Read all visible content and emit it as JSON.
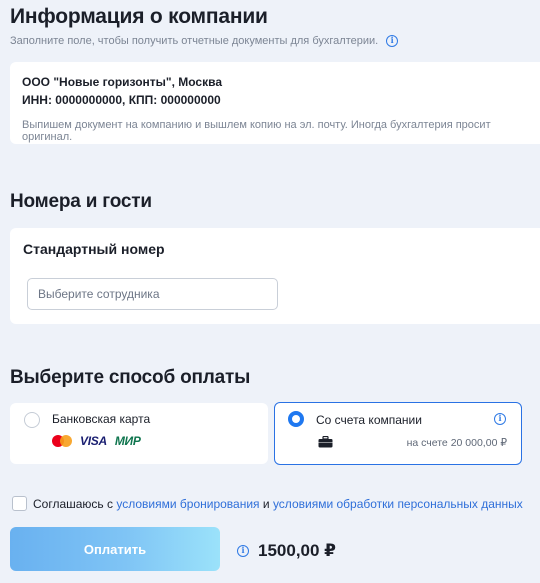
{
  "company_section": {
    "title": "Информация о компании",
    "hint": "Заполните поле, чтобы получить отчетные документы для бухгалтерии.",
    "name_line": "ООО \"Новые горизонты\", Москва",
    "ids_line": "ИНН: 0000000000, КПП: 000000000",
    "note": "Выпишем документ на компанию и вышлем копию на эл. почту. Иногда бухгалтерия просит оригинал."
  },
  "rooms_section": {
    "title": "Номера и гости",
    "room_title": "Стандартный номер",
    "employee_placeholder": "Выберите сотрудника"
  },
  "payment_section": {
    "title": "Выберите способ оплаты",
    "options": [
      {
        "label": "Банковская карта",
        "selected": false,
        "logos": [
          "mastercard-icon",
          "VISA",
          "МИР"
        ]
      },
      {
        "label": "Со счета компании",
        "selected": true,
        "balance": "на счете 20 000,00 ₽"
      }
    ]
  },
  "agreement": {
    "prefix": "Соглашаюсь с",
    "link1": "условиями бронирования",
    "middle": "и",
    "link2": "условиями обработки персональных данных",
    "checked": false
  },
  "checkout": {
    "pay_label": "Оплатить",
    "total": "1500,00 ₽"
  },
  "colors": {
    "accent": "#2a72e4",
    "background": "#eef2f9",
    "link": "#2f6fd9"
  }
}
